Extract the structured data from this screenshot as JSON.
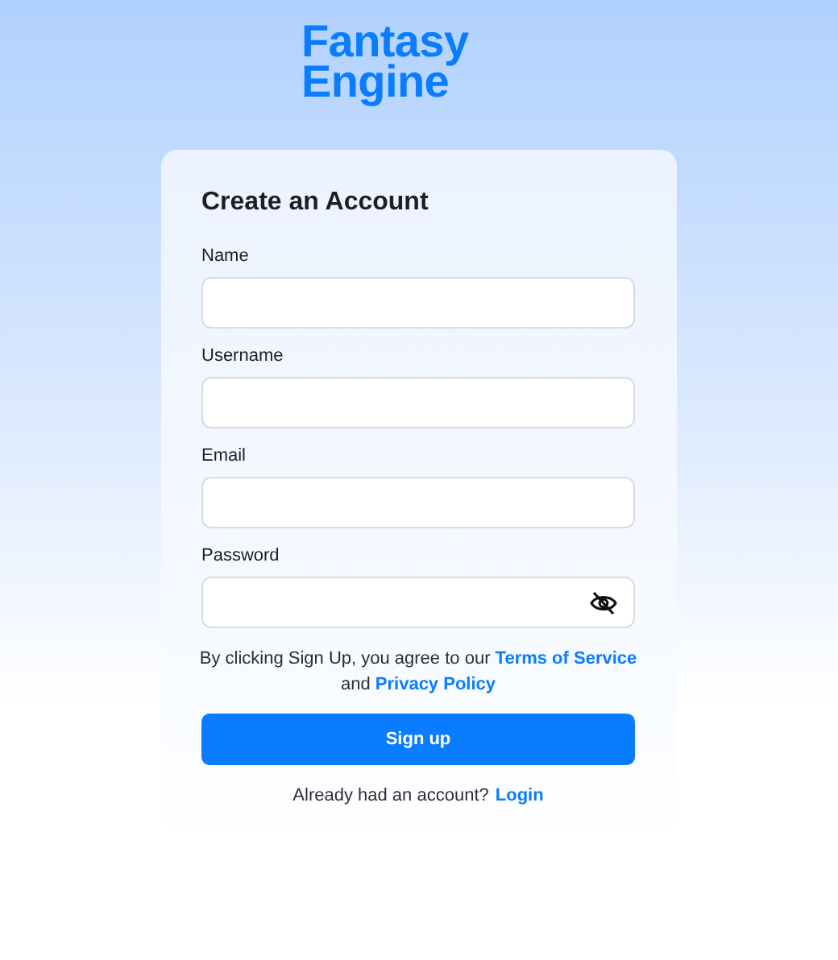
{
  "logo": [
    "Fantasy",
    "Engine"
  ],
  "form": {
    "title": "Create an Account",
    "fields": [
      {
        "label": "Name",
        "kind": "text"
      },
      {
        "label": "Username",
        "kind": "text"
      },
      {
        "label": "Email",
        "kind": "text"
      },
      {
        "label": "Password",
        "kind": "password"
      }
    ],
    "agreement": {
      "before": "By clicking Sign Up, you agree to our",
      "terms_link": "Terms of Service",
      "middle": "and",
      "privacy_link": "Privacy Policy"
    },
    "submit": "Sign up",
    "login_prompt": {
      "text": "Already had an account?",
      "link": "Login"
    }
  }
}
